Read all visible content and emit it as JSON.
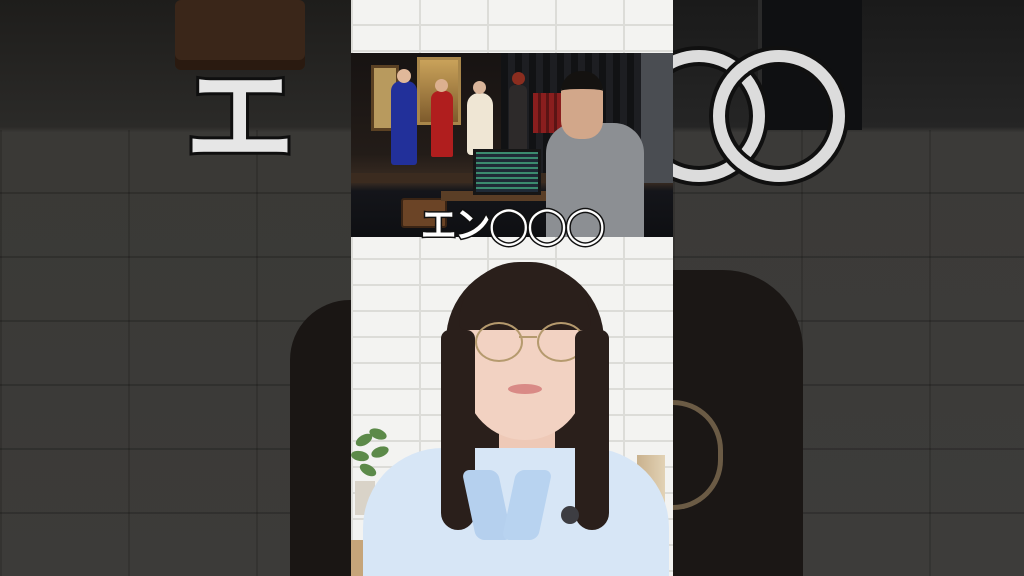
{
  "video": {
    "caption": "エン◯◯◯",
    "background_caption_fragment": "エ"
  },
  "colors": {
    "caption_fill": "#ffffff",
    "caption_stroke": "#111111",
    "blouse": "#d7e6f6",
    "wall": "#f3f3f1"
  }
}
